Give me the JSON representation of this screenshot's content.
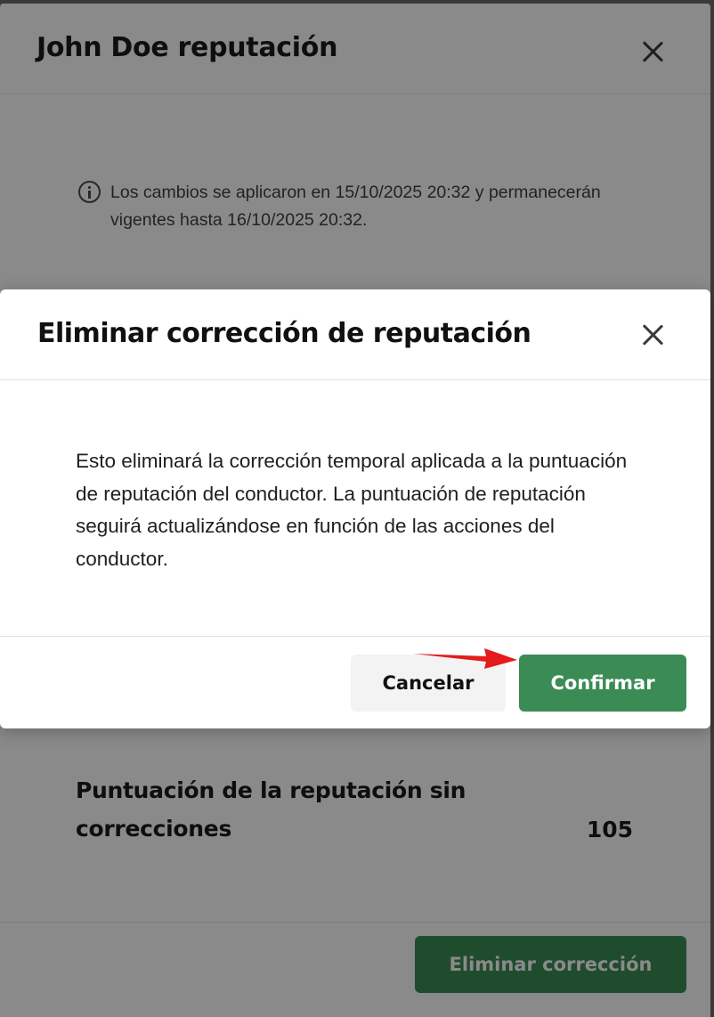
{
  "background_panel": {
    "title": "John Doe reputación",
    "close_icon": "close-icon",
    "info_icon": "info-icon",
    "info_text": "Los cambios se aplicaron en 15/10/2025 20:32 y permanecerán vigentes hasta 16/10/2025 20:32.",
    "score_label": "Puntuación de la reputación sin correcciones",
    "score_value": "105",
    "remove_button_label": "Eliminar corrección"
  },
  "dialog": {
    "title": "Eliminar corrección de reputación",
    "close_icon": "close-icon",
    "body": "Esto eliminará la corrección temporal aplicada a la puntuación de reputación del conductor. La puntuación de reputación seguirá actualizándose en función de las acciones del conductor.",
    "cancel_label": "Cancelar",
    "confirm_label": "Confirmar"
  },
  "annotation": {
    "arrow_color": "#e31b1b"
  },
  "colors": {
    "primary_green": "#3a8b54",
    "overlay": "rgba(0,0,0,0.46)"
  }
}
